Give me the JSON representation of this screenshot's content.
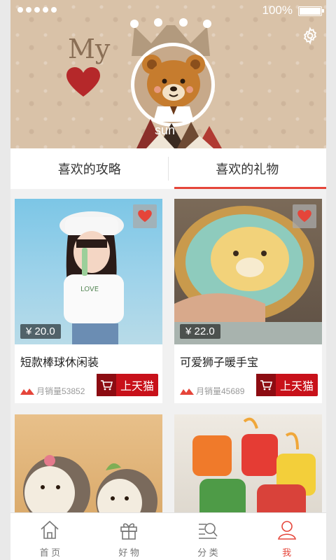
{
  "status_bar": {
    "battery": "100%"
  },
  "header": {
    "decor_text": "My",
    "username": "sun",
    "settings_icon": "gear-icon",
    "background": "#d9c2a8"
  },
  "tabs": [
    {
      "label": "喜欢的攻略",
      "active": false
    },
    {
      "label": "喜欢的礼物",
      "active": true
    }
  ],
  "accent_color": "#e5453a",
  "tmall_color": "#c8111a",
  "products": [
    {
      "title": "短款棒球休闲装",
      "price": "¥ 20.0",
      "sales": "月销量53852",
      "button": "上天猫"
    },
    {
      "title": "可爱狮子暖手宝",
      "price": "¥ 22.0",
      "sales": "月销量45689",
      "button": "上天猫"
    },
    {
      "title": "",
      "price": "",
      "sales": "",
      "button": ""
    },
    {
      "title": "",
      "price": "",
      "sales": "",
      "button": ""
    }
  ],
  "bottom_nav": [
    {
      "label": "首 页",
      "icon": "home-icon"
    },
    {
      "label": "好 物",
      "icon": "gift-icon"
    },
    {
      "label": "分 类",
      "icon": "category-search-icon"
    },
    {
      "label": "我",
      "icon": "user-icon",
      "active": true
    }
  ]
}
